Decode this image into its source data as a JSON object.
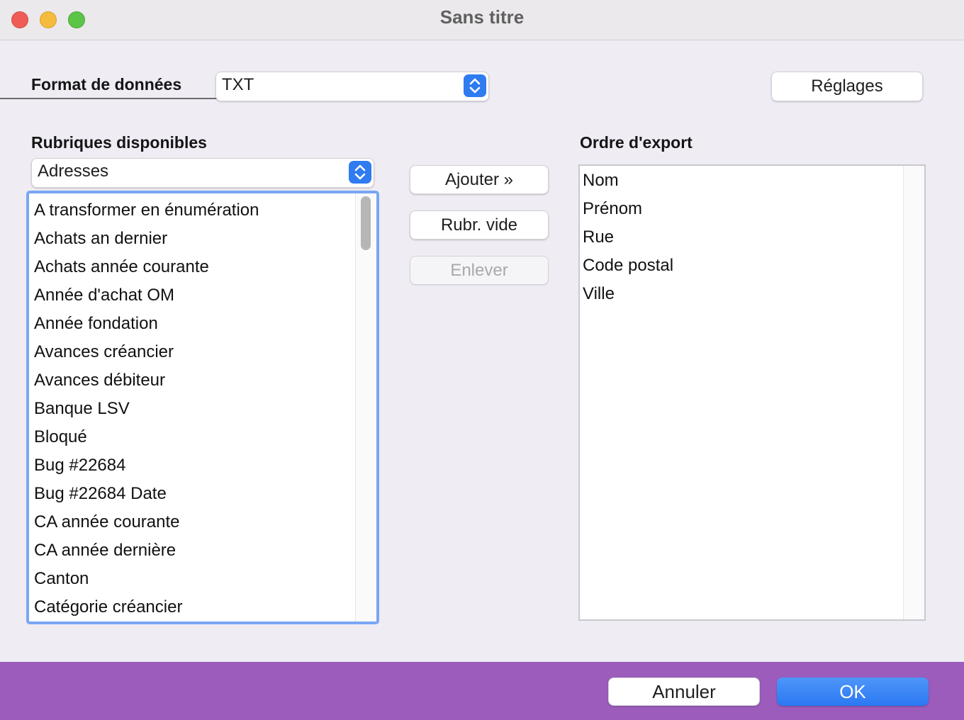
{
  "window": {
    "title": "Sans titre"
  },
  "format": {
    "label": "Format de données",
    "value": "TXT",
    "settings_button": "Réglages"
  },
  "available": {
    "heading": "Rubriques disponibles",
    "source_value": "Adresses",
    "items": [
      "A transformer en énumération",
      "Achats an dernier",
      "Achats année courante",
      "Année d'achat OM",
      "Année fondation",
      "Avances créancier",
      "Avances débiteur",
      "Banque LSV",
      "Bloqué",
      "Bug #22684",
      "Bug #22684 Date",
      "CA année courante",
      "CA année dernière",
      "Canton",
      "Catégorie créancier"
    ]
  },
  "actions": {
    "add": "Ajouter »",
    "empty_field": "Rubr. vide",
    "remove": "Enlever"
  },
  "export_order": {
    "heading": "Ordre d'export",
    "items": [
      "Nom",
      "Prénom",
      "Rue",
      "Code postal",
      "Ville"
    ]
  },
  "footer": {
    "cancel": "Annuler",
    "ok": "OK"
  },
  "colors": {
    "accent": "#2f7bf0",
    "footer_bg": "#9b5cbc",
    "focus_ring": "#7aa6f5"
  },
  "icons": {
    "popup_arrows": "chevron-up-down-icon"
  }
}
